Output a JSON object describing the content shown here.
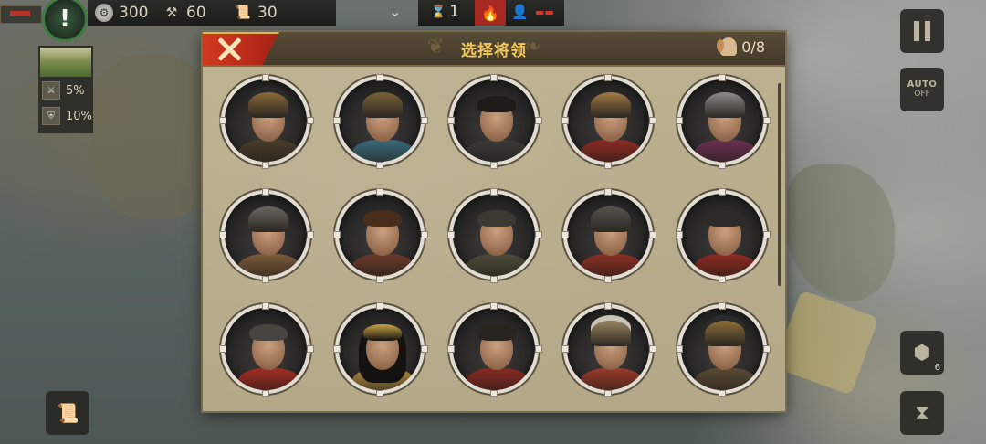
{
  "resources": {
    "silver": "300",
    "iron": "60",
    "supplies": "30"
  },
  "status": {
    "turn": "1"
  },
  "left_panel": {
    "stat1": "5%",
    "stat2": "10%"
  },
  "side_buttons": {
    "auto_line1": "AUTO",
    "auto_line2": "OFF",
    "hex_count": "6"
  },
  "modal": {
    "title": "选择将领",
    "selected_count": "0/8"
  },
  "generals": [
    {
      "name": "crested-helmet-general-1",
      "style": "helmet",
      "helmet_color": "#8a6a3a",
      "armor": "#4a3d2c",
      "crest": "#2a2a2a"
    },
    {
      "name": "bronze-cap-general",
      "style": "helmet",
      "helmet_color": "#7a6236",
      "armor": "#3a6a7a",
      "crest": ""
    },
    {
      "name": "bare-head-general-1",
      "style": "hair",
      "hair_color": "#1e1b18",
      "armor": "#3b3a37"
    },
    {
      "name": "lion-pelt-general",
      "style": "helmet",
      "helmet_color": "#a27a44",
      "armor": "#8c2b24",
      "crest": ""
    },
    {
      "name": "steel-helmet-general",
      "style": "helmet",
      "helmet_color": "#8d8c8a",
      "armor": "#6a3050",
      "crest": ""
    },
    {
      "name": "winged-helmet-general",
      "style": "helmet",
      "helmet_color": "#6b6760",
      "armor": "#7a5a3a",
      "crest": ""
    },
    {
      "name": "young-general",
      "style": "hair",
      "hair_color": "#4a2e1c",
      "armor": "#6a3a2a"
    },
    {
      "name": "bare-head-general-2",
      "style": "hair",
      "hair_color": "#3c3832",
      "armor": "#4d4a3a"
    },
    {
      "name": "iron-helmet-general",
      "style": "helmet",
      "helmet_color": "#56534f",
      "armor": "#8a2f24",
      "crest": ""
    },
    {
      "name": "red-cloak-general-1",
      "style": "hair",
      "hair_color": "#2c2a28",
      "armor": "#8e2a22"
    },
    {
      "name": "red-cloak-general-2",
      "style": "hair",
      "hair_color": "#4a4440",
      "armor": "#a32d23"
    },
    {
      "name": "queen-general",
      "style": "longhair",
      "hair_color": "#141210",
      "armor": "#b38a3c"
    },
    {
      "name": "bearded-general",
      "style": "hair",
      "hair_color": "#2a2420",
      "armor": "#8a2a22"
    },
    {
      "name": "crested-helmet-general-2",
      "style": "helmet",
      "helmet_color": "#9a8660",
      "armor": "#9a3a2a",
      "crest": "#c9c3b8"
    },
    {
      "name": "crested-helmet-general-3",
      "style": "helmet",
      "helmet_color": "#8c6d3a",
      "armor": "#5a4a34",
      "crest": "#2a2a2a"
    }
  ],
  "colors": {
    "close_red": "#c4301c",
    "title_gold": "#f1c95a",
    "panel_beige": "#b8ad8d"
  }
}
